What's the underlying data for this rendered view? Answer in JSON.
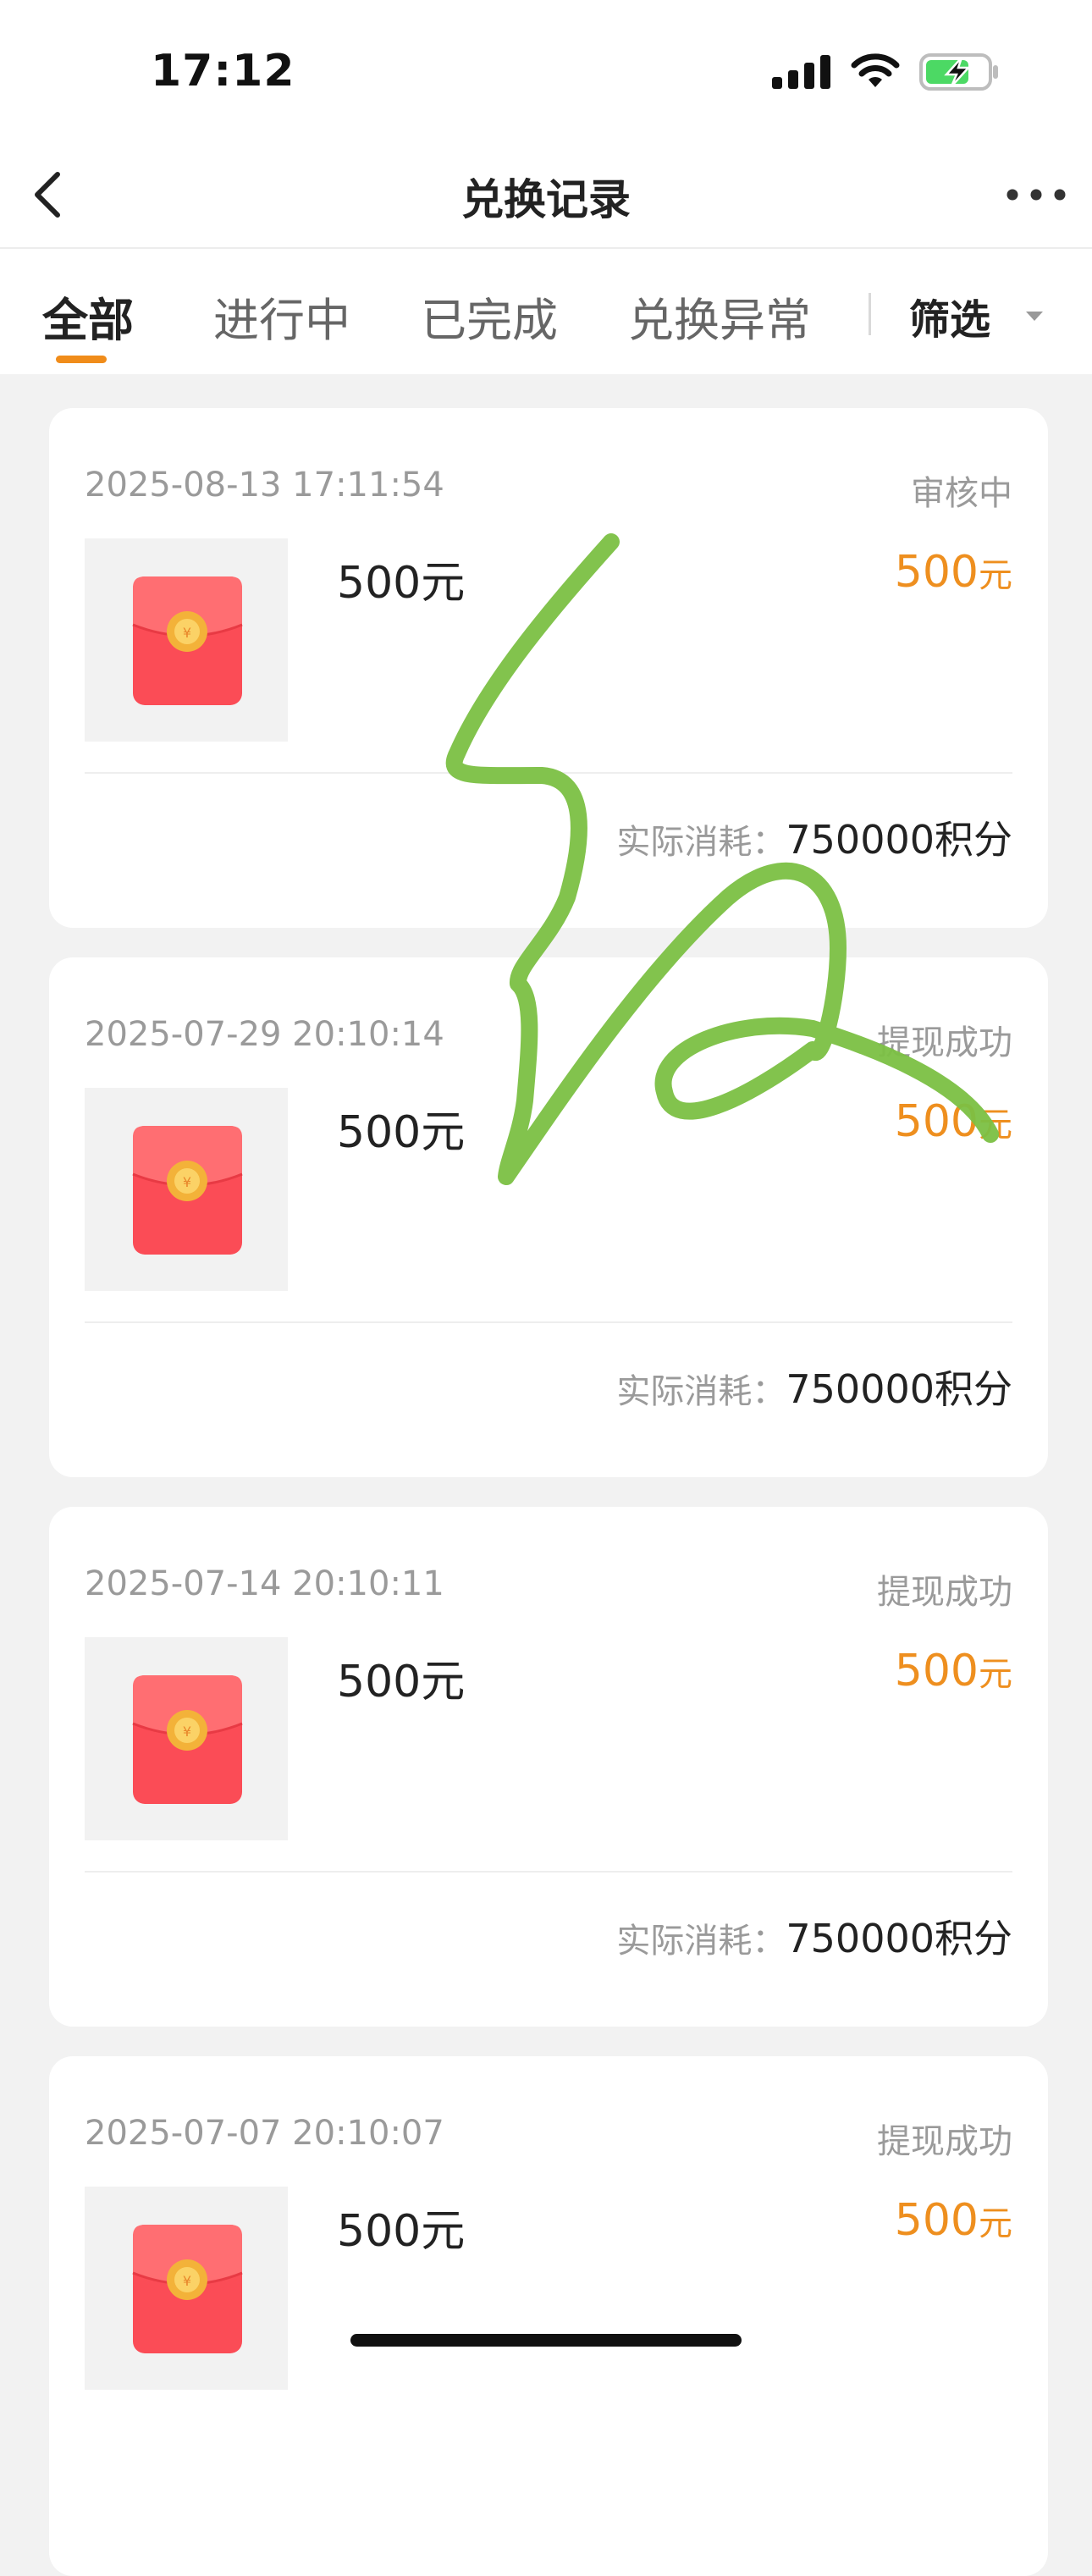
{
  "status_bar": {
    "time": "17:12"
  },
  "nav": {
    "title": "兑换记录"
  },
  "tabs": {
    "items": [
      {
        "label": "全部",
        "active": true
      },
      {
        "label": "进行中",
        "active": false
      },
      {
        "label": "已完成",
        "active": false
      },
      {
        "label": "兑换异常",
        "active": false
      }
    ],
    "filter_label": "筛选"
  },
  "icons": {
    "back": "chevron-left-icon",
    "more": "more-horizontal-icon",
    "thumbnail": "red-envelope-icon",
    "signal": "cellular-signal-icon",
    "wifi": "wifi-icon",
    "battery": "battery-charging-icon"
  },
  "colors": {
    "accent": "#ee8f1f",
    "battery": "#4cd964",
    "signature": "#7bc043"
  },
  "records": [
    {
      "time": "2025-08-13 17:11:54",
      "status": "审核中",
      "name": "500元",
      "amount": "500",
      "unit": "元",
      "cost_label": "实际消耗：",
      "cost_value": "750000积分"
    },
    {
      "time": "2025-07-29 20:10:14",
      "status": "提现成功",
      "name": "500元",
      "amount": "500",
      "unit": "元",
      "cost_label": "实际消耗：",
      "cost_value": "750000积分"
    },
    {
      "time": "2025-07-14 20:10:11",
      "status": "提现成功",
      "name": "500元",
      "amount": "500",
      "unit": "元",
      "cost_label": "实际消耗：",
      "cost_value": "750000积分"
    },
    {
      "time": "2025-07-07 20:10:07",
      "status": "提现成功",
      "name": "500元",
      "amount": "500",
      "unit": "元"
    }
  ]
}
